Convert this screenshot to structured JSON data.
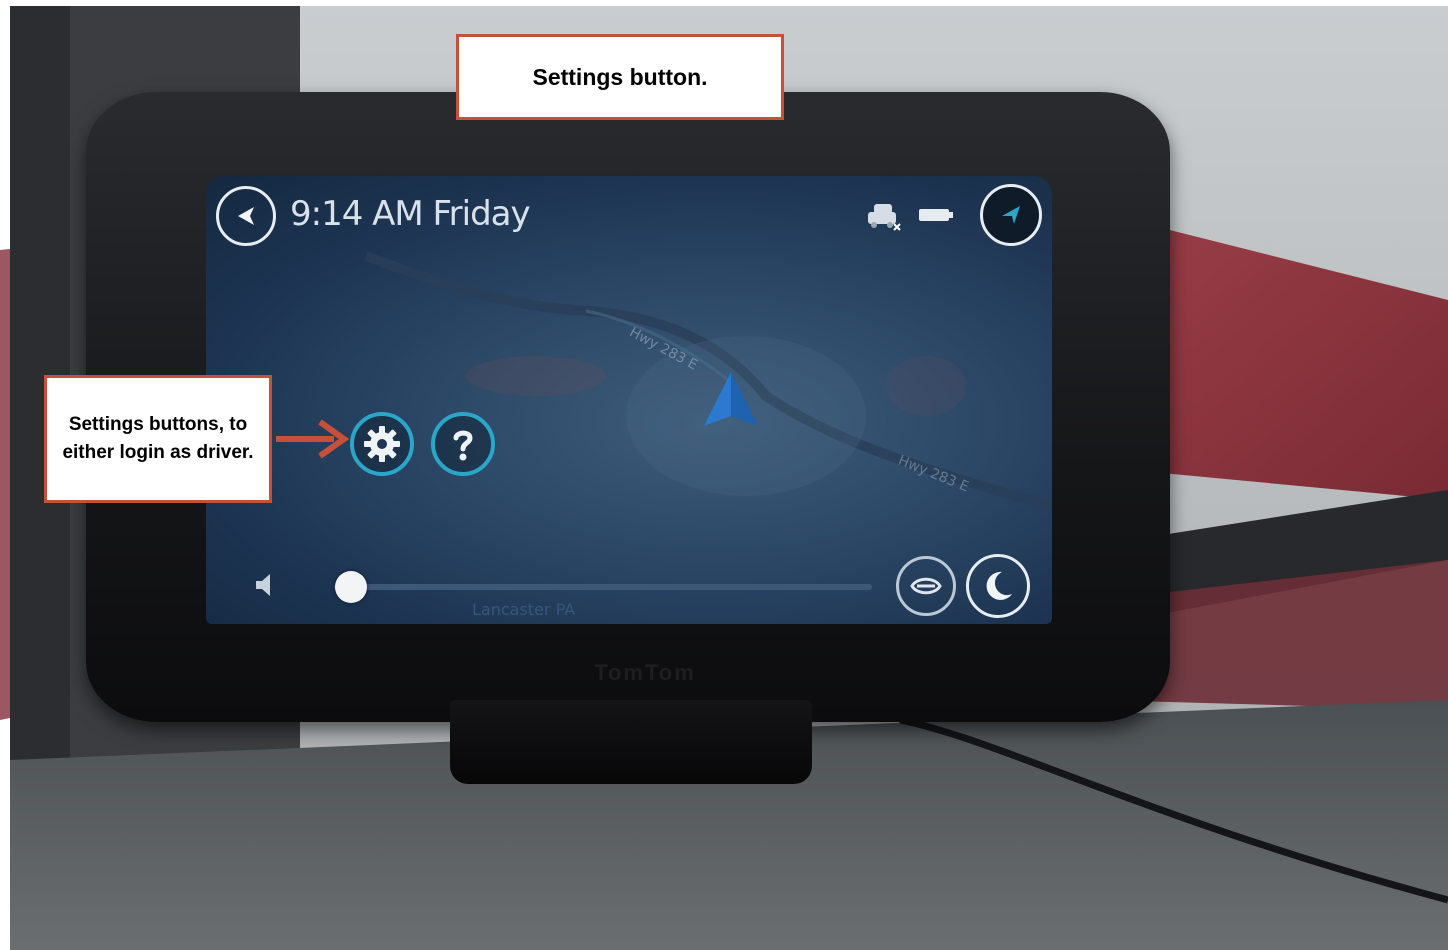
{
  "screen": {
    "clock_text": "9:14 AM Friday",
    "road_label_1": "Hwy 283 E",
    "road_label_2": "Hwy 283 E",
    "place_label": "Lancaster PA",
    "volume_level": 0.02
  },
  "device": {
    "brand": "TomTom"
  },
  "callouts": {
    "top": "Settings button.",
    "left": "Settings buttons, to either login as driver."
  },
  "colors": {
    "accent": "#2ba6c9",
    "callout_border": "#c8503a",
    "arrow": "#c8503a"
  },
  "icons": [
    "back-icon",
    "traffic-icon",
    "battery-icon",
    "navigation-arrow-icon",
    "gear-icon",
    "help-icon",
    "volume-icon",
    "voice-icon",
    "night-mode-icon",
    "vehicle-marker-icon"
  ]
}
